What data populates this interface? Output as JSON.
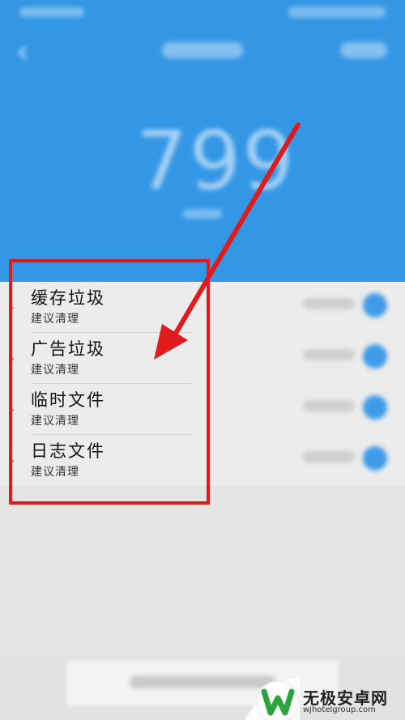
{
  "header": {
    "big_number": "799"
  },
  "items": [
    {
      "title": "缓存垃圾",
      "subtitle": "建议清理"
    },
    {
      "title": "广告垃圾",
      "subtitle": "建议清理"
    },
    {
      "title": "临时文件",
      "subtitle": "建议清理"
    },
    {
      "title": "日志文件",
      "subtitle": "建议清理"
    }
  ],
  "watermark": {
    "brand": "无极安卓网",
    "url": "wjhotelgroup.com"
  },
  "colors": {
    "header_blue": "#3497e6",
    "annotation_red": "#e01b1b",
    "check_blue": "#3f9be8"
  }
}
